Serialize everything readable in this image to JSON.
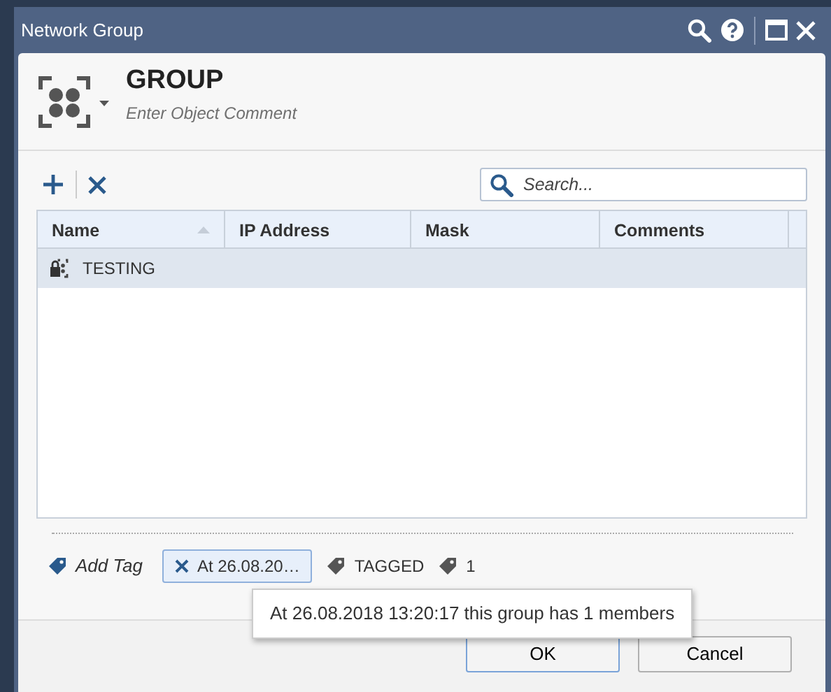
{
  "window": {
    "title": "Network Group"
  },
  "object": {
    "name": "GROUP",
    "placeholder": "Enter Object Comment"
  },
  "search": {
    "placeholder": "Search..."
  },
  "table": {
    "columns": [
      {
        "label": "Name",
        "sorted": true
      },
      {
        "label": "IP Address",
        "sorted": false
      },
      {
        "label": "Mask",
        "sorted": false
      },
      {
        "label": "Comments",
        "sorted": false
      }
    ],
    "rows": [
      {
        "name": "TESTING",
        "selected": true
      }
    ]
  },
  "tags": [
    {
      "kind": "add",
      "label": "Add Tag"
    },
    {
      "kind": "removable",
      "label": "At 26.08.20…",
      "selected": true
    },
    {
      "kind": "tag",
      "label": "TAGGED"
    },
    {
      "kind": "tag",
      "label": "1"
    }
  ],
  "tooltip": {
    "text": "At 26.08.2018 13:20:17 this group has 1 members"
  },
  "buttons": [
    {
      "label": "OK",
      "default": true
    },
    {
      "label": "Cancel",
      "default": false
    }
  ]
}
